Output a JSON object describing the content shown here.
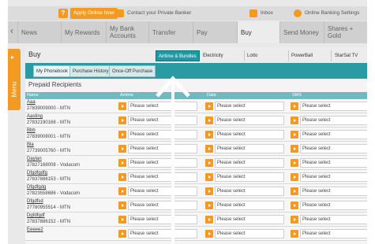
{
  "topbar": {
    "help_icon": "?",
    "apply_label": "Apply Online Now",
    "contact_label": "Contact your Private Banker",
    "inbox_label": "Inbox",
    "settings_label": "Online Banking Settings"
  },
  "nav": {
    "items": [
      {
        "label": "News"
      },
      {
        "label": "My Rewards"
      },
      {
        "label": "My Bank Accounts"
      },
      {
        "label": "Transfer"
      },
      {
        "label": "Pay"
      },
      {
        "label": "Buy"
      },
      {
        "label": "Send Money"
      },
      {
        "label": "Shares + Gold"
      }
    ]
  },
  "menu": {
    "label": "Menu"
  },
  "buy": {
    "title": "Buy",
    "services": [
      "Airtime & Bundles",
      "Electricity",
      "Lotto",
      "PowerBall",
      "StarSat TV"
    ],
    "subtabs": [
      "My Phonebook",
      "Purchase History",
      "Once-Off Purchase"
    ]
  },
  "recipients": {
    "title": "Prepaid Recipients",
    "columns": [
      "Name",
      "Airtime",
      "Data",
      "SMS"
    ],
    "select_placeholder": "Please select",
    "rows": [
      {
        "name": "Aaa",
        "number": "27839009000 - MTN"
      },
      {
        "name": "Aasting",
        "number": "27832190168 - MTN"
      },
      {
        "name": "Bbb",
        "number": "27839008001 - MTN"
      },
      {
        "name": "Bla",
        "number": "27739005760 - MTN"
      },
      {
        "name": "Daylan",
        "number": "27827168008 - Vodacom"
      },
      {
        "name": "Dfgdfgdfg",
        "number": "27837886153 - MTN"
      },
      {
        "name": "Dfgdfgdg",
        "number": "27823558686 - Vodacom"
      },
      {
        "name": "Dfgdfsd",
        "number": "27780955514 - MTN"
      },
      {
        "name": "Dgfdfgdf",
        "number": "27837886152 - MTN"
      },
      {
        "name": "Eeeee2",
        "number": ""
      }
    ]
  },
  "colors": {
    "accent": "#f29a22",
    "teal": "#2a9aa3",
    "header": "#6fb9bf"
  }
}
